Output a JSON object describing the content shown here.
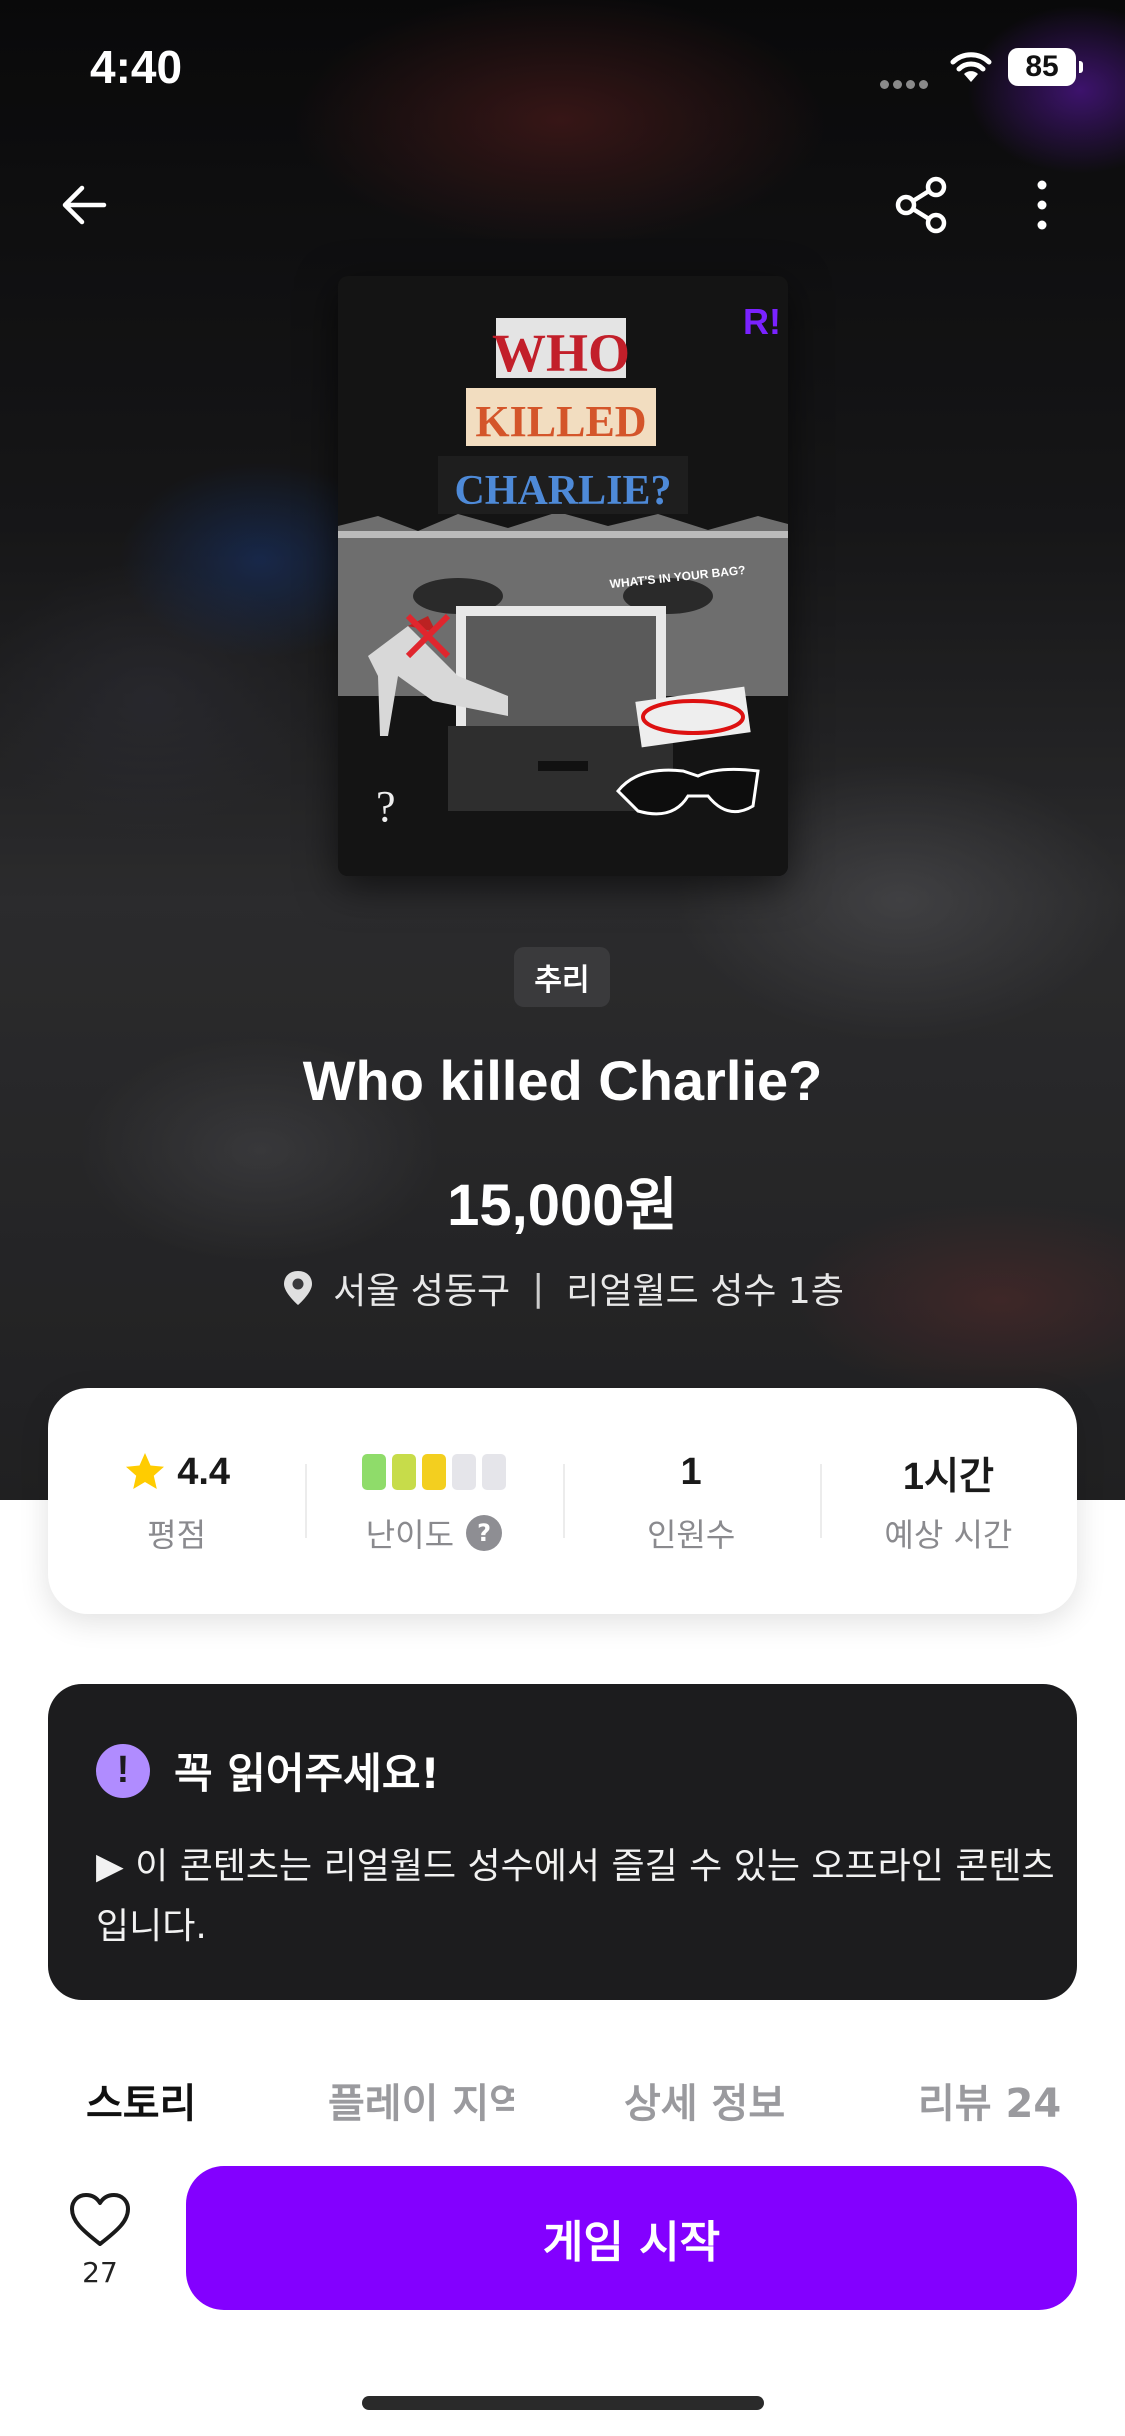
{
  "status_bar": {
    "time": "4:40",
    "battery": "85"
  },
  "header": {
    "back_icon": "arrow-left-icon",
    "share_icon": "share-icon",
    "more_icon": "more-vertical-icon"
  },
  "poster": {
    "line1": "WHO",
    "line2": "KILLED",
    "line3": "CHARLIE?",
    "tagline": "WHAT'S IN YOUR BAG?",
    "logo": "R!"
  },
  "game": {
    "genre": "추리",
    "title": "Who killed Charlie?",
    "price": "15,000원",
    "location_city": "서울 성동구",
    "location_sep": "|",
    "location_venue": "리얼월드 성수 1층"
  },
  "info": {
    "rating_value": "4.4",
    "rating_label": "평점",
    "difficulty_label": "난이도",
    "difficulty_level": 3,
    "difficulty_max": 5,
    "difficulty_colors": [
      "#8fdc6a",
      "#c7dc4a",
      "#f3cf1f",
      "#e5e5ea",
      "#e5e5ea"
    ],
    "players_value": "1",
    "players_label": "인원수",
    "time_value": "1시간",
    "time_label": "예상 시간"
  },
  "notice": {
    "icon": "!",
    "title": "꼭 읽어주세요!",
    "body": "▶ 이 콘텐츠는 리얼월드 성수에서 즐길 수 있는 오프라인 콘텐츠입니다."
  },
  "tabs": [
    {
      "label": "스토리"
    },
    {
      "label": "플레이 지역"
    },
    {
      "label": "상세 정보"
    },
    {
      "label": "리뷰 24"
    }
  ],
  "bottom": {
    "like_count": "27",
    "start_label": "게임 시작"
  },
  "colors": {
    "brand": "#8300ff",
    "notice_bg": "#1c1c1e",
    "notice_icon": "#b08cff",
    "star": "#ffcc00"
  }
}
